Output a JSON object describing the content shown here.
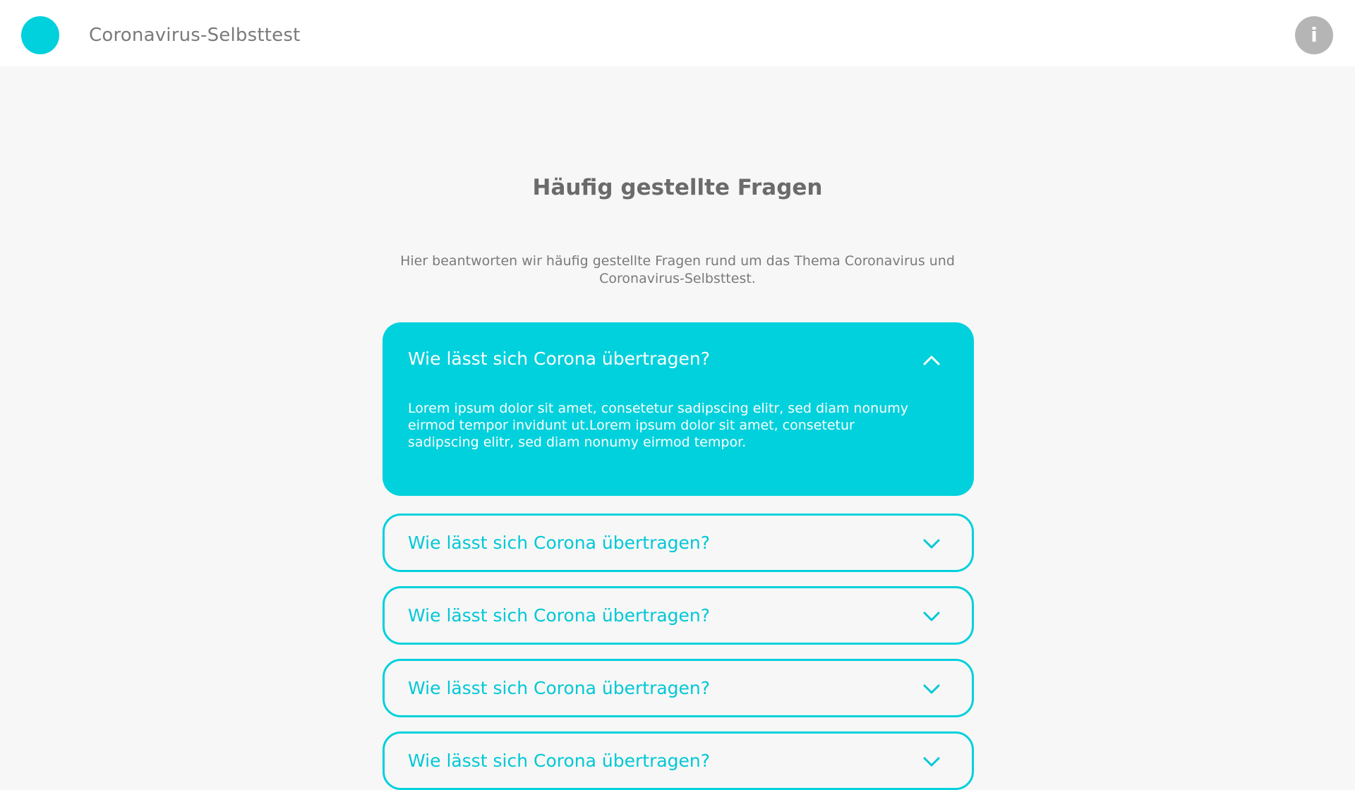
{
  "header": {
    "app_title": "Coronavirus-Selbsttest",
    "info_label": "i"
  },
  "main": {
    "title": "Häufig gestellte Fragen",
    "intro": "Hier beantworten wir häufig gestellte Fragen rund um das Thema Coronavirus und Coronavirus-Selbsttest."
  },
  "faq": [
    {
      "question": "Wie lässt sich Corona übertragen?",
      "answer": "Lorem ipsum dolor sit amet, consetetur sadipscing elitr, sed diam nonumy eirmod tempor invidunt ut.Lorem ipsum dolor sit amet, consetetur sadipscing elitr, sed diam nonumy eirmod tempor.",
      "expanded": true
    },
    {
      "question": "Wie lässt sich Corona übertragen?",
      "expanded": false
    },
    {
      "question": "Wie lässt sich Corona übertragen?",
      "expanded": false
    },
    {
      "question": "Wie lässt sich Corona übertragen?",
      "expanded": false
    },
    {
      "question": "Wie lässt sich Corona übertragen?",
      "expanded": false
    }
  ],
  "colors": {
    "accent": "#00d1dc",
    "header_bg": "#ffffff",
    "page_bg": "#f7f7f7",
    "info_button": "#b5b5b5",
    "text_gray": "#7a7a7a"
  },
  "icons": {
    "logo": "circle-logo-icon",
    "info": "info-icon",
    "expanded": "chevron-up-icon",
    "collapsed": "chevron-down-icon"
  }
}
